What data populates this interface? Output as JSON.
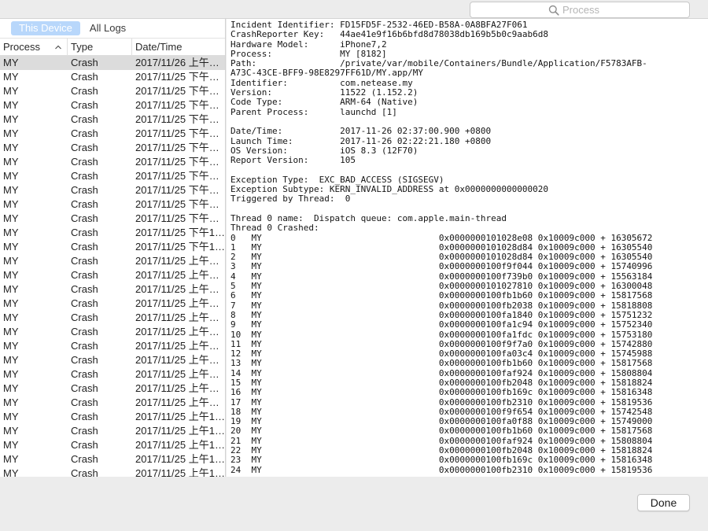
{
  "search": {
    "placeholder": "Process"
  },
  "segmented": {
    "items": [
      "This Device",
      "All Logs"
    ],
    "active": 0
  },
  "table": {
    "headers": {
      "process": "Process",
      "type": "Type",
      "date": "Date/Time"
    },
    "rows": [
      {
        "process": "MY",
        "type": "Crash",
        "date": "2017/11/26 上午…"
      },
      {
        "process": "MY",
        "type": "Crash",
        "date": "2017/11/25 下午…"
      },
      {
        "process": "MY",
        "type": "Crash",
        "date": "2017/11/25 下午…"
      },
      {
        "process": "MY",
        "type": "Crash",
        "date": "2017/11/25 下午…"
      },
      {
        "process": "MY",
        "type": "Crash",
        "date": "2017/11/25 下午…"
      },
      {
        "process": "MY",
        "type": "Crash",
        "date": "2017/11/25 下午…"
      },
      {
        "process": "MY",
        "type": "Crash",
        "date": "2017/11/25 下午…"
      },
      {
        "process": "MY",
        "type": "Crash",
        "date": "2017/11/25 下午…"
      },
      {
        "process": "MY",
        "type": "Crash",
        "date": "2017/11/25 下午…"
      },
      {
        "process": "MY",
        "type": "Crash",
        "date": "2017/11/25 下午…"
      },
      {
        "process": "MY",
        "type": "Crash",
        "date": "2017/11/25 下午…"
      },
      {
        "process": "MY",
        "type": "Crash",
        "date": "2017/11/25 下午…"
      },
      {
        "process": "MY",
        "type": "Crash",
        "date": "2017/11/25 下午1…"
      },
      {
        "process": "MY",
        "type": "Crash",
        "date": "2017/11/25 下午1…"
      },
      {
        "process": "MY",
        "type": "Crash",
        "date": "2017/11/25 上午…"
      },
      {
        "process": "MY",
        "type": "Crash",
        "date": "2017/11/25 上午…"
      },
      {
        "process": "MY",
        "type": "Crash",
        "date": "2017/11/25 上午…"
      },
      {
        "process": "MY",
        "type": "Crash",
        "date": "2017/11/25 上午…"
      },
      {
        "process": "MY",
        "type": "Crash",
        "date": "2017/11/25 上午…"
      },
      {
        "process": "MY",
        "type": "Crash",
        "date": "2017/11/25 上午…"
      },
      {
        "process": "MY",
        "type": "Crash",
        "date": "2017/11/25 上午…"
      },
      {
        "process": "MY",
        "type": "Crash",
        "date": "2017/11/25 上午…"
      },
      {
        "process": "MY",
        "type": "Crash",
        "date": "2017/11/25 上午…"
      },
      {
        "process": "MY",
        "type": "Crash",
        "date": "2017/11/25 上午…"
      },
      {
        "process": "MY",
        "type": "Crash",
        "date": "2017/11/25 上午…"
      },
      {
        "process": "MY",
        "type": "Crash",
        "date": "2017/11/25 上午1…"
      },
      {
        "process": "MY",
        "type": "Crash",
        "date": "2017/11/25 上午1…"
      },
      {
        "process": "MY",
        "type": "Crash",
        "date": "2017/11/25 上午1…"
      },
      {
        "process": "MY",
        "type": "Crash",
        "date": "2017/11/25 上午1…"
      },
      {
        "process": "MY",
        "type": "Crash",
        "date": "2017/11/25 上午1…"
      },
      {
        "process": "MY",
        "type": "Crash",
        "date": "2017/11/25 上午1…"
      }
    ],
    "selected_index": 0
  },
  "log": {
    "text": "Incident Identifier: FD15FD5F-2532-46ED-B58A-0A8BFA27F061\nCrashReporter Key:   44ae41e9f16b6bfd8d78038db169b5b0c9aab6d8\nHardware Model:      iPhone7,2\nProcess:             MY [8182]\nPath:                /private/var/mobile/Containers/Bundle/Application/F5783AFB-\nA73C-43CE-BFF9-98E8297FF61D/MY.app/MY\nIdentifier:          com.netease.my\nVersion:             11522 (1.152.2)\nCode Type:           ARM-64 (Native)\nParent Process:      launchd [1]\n\nDate/Time:           2017-11-26 02:37:00.900 +0800\nLaunch Time:         2017-11-26 02:22:21.180 +0800\nOS Version:          iOS 8.3 (12F70)\nReport Version:      105\n\nException Type:  EXC_BAD_ACCESS (SIGSEGV)\nException Subtype: KERN_INVALID_ADDRESS at 0x0000000000000020\nTriggered by Thread:  0\n\nThread 0 name:  Dispatch queue: com.apple.main-thread\nThread 0 Crashed:\n0   MY                                  0x0000000101028e08 0x10009c000 + 16305672\n1   MY                                  0x0000000101028d84 0x10009c000 + 16305540\n2   MY                                  0x0000000101028d84 0x10009c000 + 16305540\n3   MY                                  0x0000000100f9f044 0x10009c000 + 15740996\n4   MY                                  0x0000000100f739b0 0x10009c000 + 15563184\n5   MY                                  0x0000000101027810 0x10009c000 + 16300048\n6   MY                                  0x0000000100fb1b60 0x10009c000 + 15817568\n7   MY                                  0x0000000100fb2038 0x10009c000 + 15818808\n8   MY                                  0x0000000100fa1840 0x10009c000 + 15751232\n9   MY                                  0x0000000100fa1c94 0x10009c000 + 15752340\n10  MY                                  0x0000000100fa1fdc 0x10009c000 + 15753180\n11  MY                                  0x0000000100f9f7a0 0x10009c000 + 15742880\n12  MY                                  0x0000000100fa03c4 0x10009c000 + 15745988\n13  MY                                  0x0000000100fb1b60 0x10009c000 + 15817568\n14  MY                                  0x0000000100faf924 0x10009c000 + 15808804\n15  MY                                  0x0000000100fb2048 0x10009c000 + 15818824\n16  MY                                  0x0000000100fb169c 0x10009c000 + 15816348\n17  MY                                  0x0000000100fb2310 0x10009c000 + 15819536\n18  MY                                  0x0000000100f9f654 0x10009c000 + 15742548\n19  MY                                  0x0000000100fa0f88 0x10009c000 + 15749000\n20  MY                                  0x0000000100fb1b60 0x10009c000 + 15817568\n21  MY                                  0x0000000100faf924 0x10009c000 + 15808804\n22  MY                                  0x0000000100fb2048 0x10009c000 + 15818824\n23  MY                                  0x0000000100fb169c 0x10009c000 + 15816348\n24  MY                                  0x0000000100fb2310 0x10009c000 + 15819536"
  },
  "footer": {
    "done_label": "Done"
  },
  "icons": {
    "search": "search-icon",
    "sort": "chevron-up-icon"
  }
}
